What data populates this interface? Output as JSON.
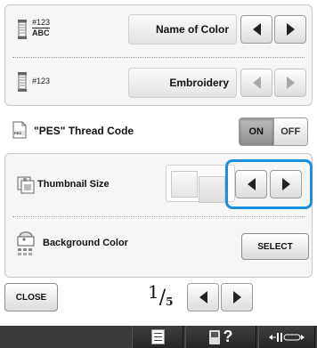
{
  "settings": {
    "thread_number_display": {
      "sample_number": "#123",
      "sample_name": "ABC",
      "value": "Name of Color"
    },
    "thread_brand": {
      "sample_number": "#123",
      "value": "Embroidery"
    },
    "pes_thread_code": {
      "label": "\"PES\" Thread Code",
      "icon_text": "PES",
      "on_label": "ON",
      "off_label": "OFF",
      "selected": "ON"
    },
    "thumbnail_size": {
      "label": "Thumbnail Size"
    },
    "background_color": {
      "label": "Background Color",
      "button_label": "SELECT"
    }
  },
  "footer": {
    "close_label": "CLOSE",
    "page_current": "1",
    "page_total": "5"
  },
  "statusbar": {
    "help_label": "?"
  },
  "colors": {
    "highlight": "#1a8fe0",
    "statusbar": "#3a3a3a"
  }
}
